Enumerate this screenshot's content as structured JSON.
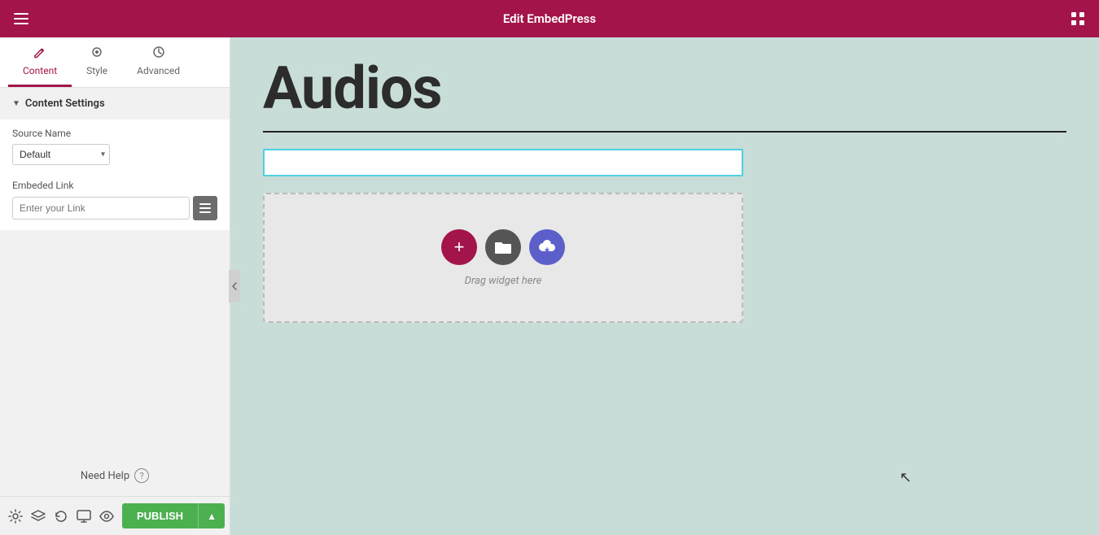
{
  "topbar": {
    "title": "Edit EmbedPress",
    "hamburger_icon": "☰",
    "grid_icon": "⊞"
  },
  "tabs": [
    {
      "id": "content",
      "label": "Content",
      "icon": "✏️",
      "active": true
    },
    {
      "id": "style",
      "label": "Style",
      "icon": "🎨",
      "active": false
    },
    {
      "id": "advanced",
      "label": "Advanced",
      "icon": "⚙️",
      "active": false
    }
  ],
  "panel": {
    "section_title": "Content Settings",
    "source_name_label": "Source Name",
    "source_name_default": "Default",
    "source_name_options": [
      "Default"
    ],
    "embed_link_label": "Embeded Link",
    "embed_link_placeholder": "Enter your Link",
    "need_help_label": "Need Help"
  },
  "canvas": {
    "page_title": "Audios",
    "drag_widget_text": "Drag widget here"
  },
  "bottom_bar": {
    "publish_label": "PUBLISH"
  }
}
